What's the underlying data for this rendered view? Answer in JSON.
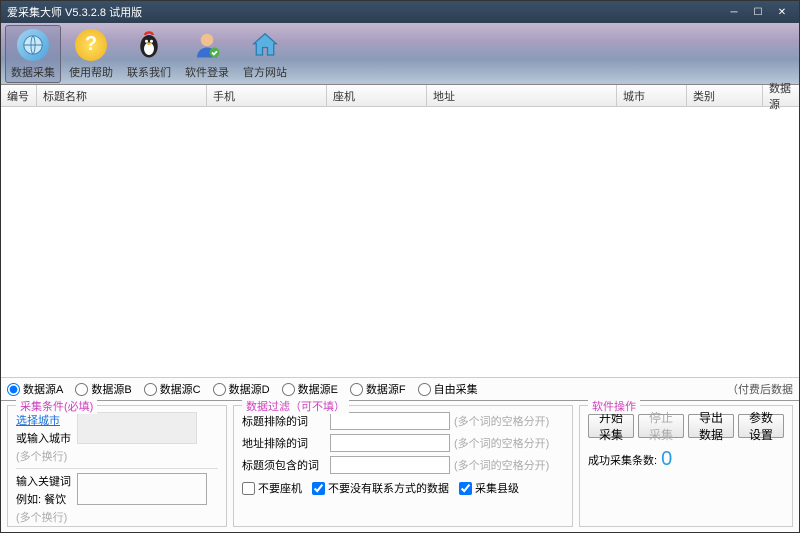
{
  "window": {
    "title": "爱采集大师 V5.3.2.8 试用版"
  },
  "toolbar": {
    "items": [
      {
        "label": "数据采集",
        "active": true
      },
      {
        "label": "使用帮助",
        "active": false
      },
      {
        "label": "联系我们",
        "active": false
      },
      {
        "label": "软件登录",
        "active": false
      },
      {
        "label": "官方网站",
        "active": false
      }
    ]
  },
  "table": {
    "columns": [
      "编号",
      "标题名称",
      "手机",
      "座机",
      "地址",
      "城市",
      "类别",
      "数据源"
    ]
  },
  "sources": {
    "options": [
      "数据源A",
      "数据源B",
      "数据源C",
      "数据源D",
      "数据源E",
      "数据源F",
      "自由采集"
    ],
    "note": "（付费后数据"
  },
  "cond": {
    "legend": "采集条件(必填)",
    "select_city": "选择城市",
    "or_input_city": "或输入城市",
    "multi_line": "(多个换行)",
    "input_kw": "输入关键词",
    "eg": "例如: 餐饮",
    "multi_line2": "(多个换行)"
  },
  "filter": {
    "legend": "数据过滤（可不填）",
    "title_exclude": "标题排除的词",
    "addr_exclude": "地址排除的词",
    "title_include": "标题须包含的词",
    "hint": "(多个词的空格分开)",
    "cb1": "不要座机",
    "cb2": "不要没有联系方式的数据",
    "cb3": "采集县级"
  },
  "ops": {
    "legend": "软件操作",
    "start": "开始采集",
    "stop": "停止采集",
    "export": "导出数据",
    "settings": "参数设置",
    "success_label": "成功采集条数:",
    "count": "0"
  }
}
